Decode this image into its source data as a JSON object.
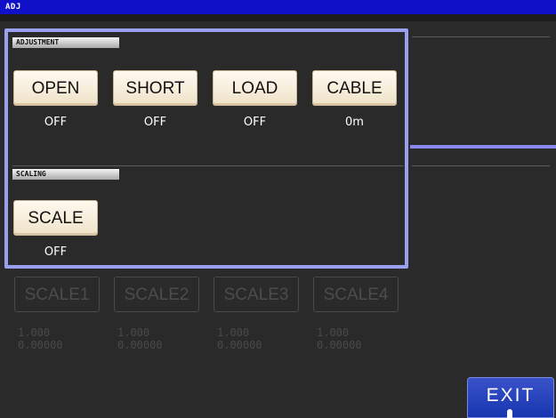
{
  "window": {
    "title": "ADJ"
  },
  "adjustment": {
    "section_label": "ADJUSTMENT",
    "buttons": [
      {
        "label": "OPEN",
        "value": "OFF"
      },
      {
        "label": "SHORT",
        "value": "OFF"
      },
      {
        "label": "LOAD",
        "value": "OFF"
      },
      {
        "label": "CABLE",
        "value": "0m"
      }
    ]
  },
  "scaling": {
    "section_label": "SCALING",
    "button": {
      "label": "SCALE",
      "value": "OFF"
    },
    "disabled_items": [
      {
        "label": "SCALE1",
        "line1": "1.000",
        "line2": "0.00000"
      },
      {
        "label": "SCALE2",
        "line1": "1.000",
        "line2": "0.00000"
      },
      {
        "label": "SCALE3",
        "line1": "1.000",
        "line2": "0.00000"
      },
      {
        "label": "SCALE4",
        "line1": "1.000",
        "line2": "0.00000"
      }
    ]
  },
  "footer": {
    "exit_label": "EXIT"
  },
  "colors": {
    "title_bar": "#1010c8",
    "selection": "#9aa0f0",
    "button_face": "#fffaf0",
    "exit_button": "#1636b0"
  }
}
